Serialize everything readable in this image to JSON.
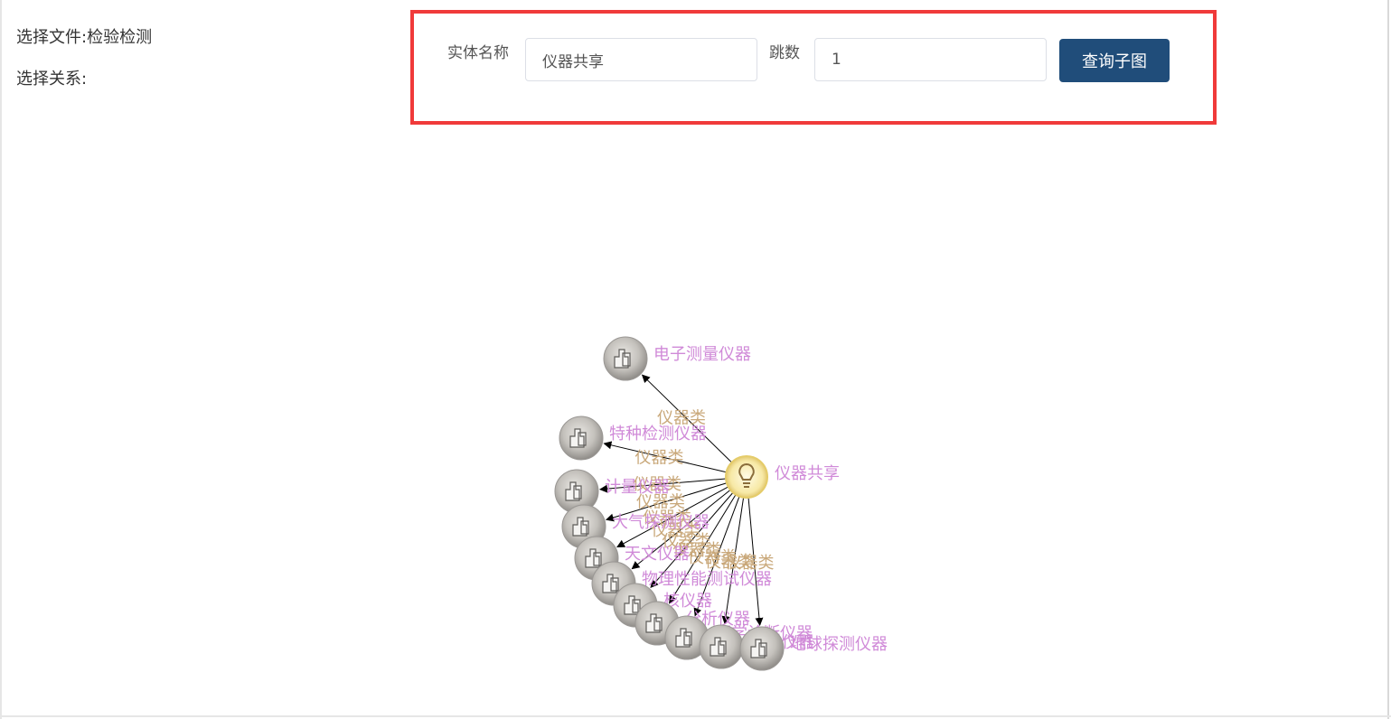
{
  "sidebar": {
    "file_label": "选择文件:检验检测",
    "relation_label": "选择关系:"
  },
  "query": {
    "entity_label": "实体名称",
    "entity_value": "仪器共享",
    "hops_label": "跳数",
    "hops_value": "1",
    "button_label": "查询子图"
  },
  "colors": {
    "highlight_border": "#f03a3a",
    "button_bg": "#204d7a",
    "node_label": "#d08ad8",
    "edge_label": "#c9a87a",
    "center_node": "#f7e9a6",
    "child_node": "#b8b6b2"
  },
  "graph": {
    "center": {
      "label": "仪器共享",
      "icon": "lightbulb-icon"
    },
    "edge_label": "仪器类",
    "children": [
      {
        "label": "电子测量仪器",
        "icon": "instrument-icon"
      },
      {
        "label": "特种检测仪器",
        "icon": "instrument-icon"
      },
      {
        "label": "计量仪器",
        "icon": "instrument-icon"
      },
      {
        "label": "大气探测仪器",
        "icon": "instrument-icon"
      },
      {
        "label": "天文仪器",
        "icon": "instrument-icon"
      },
      {
        "label": "物理性能测试仪器",
        "icon": "instrument-icon"
      },
      {
        "label": "核仪器",
        "icon": "instrument-icon"
      },
      {
        "label": "分析仪器",
        "icon": "instrument-icon"
      },
      {
        "label": "医学诊断仪器",
        "icon": "instrument-icon"
      },
      {
        "label": "海洋仪器",
        "icon": "instrument-icon"
      },
      {
        "label": "地球探测仪器",
        "icon": "instrument-icon"
      }
    ]
  }
}
